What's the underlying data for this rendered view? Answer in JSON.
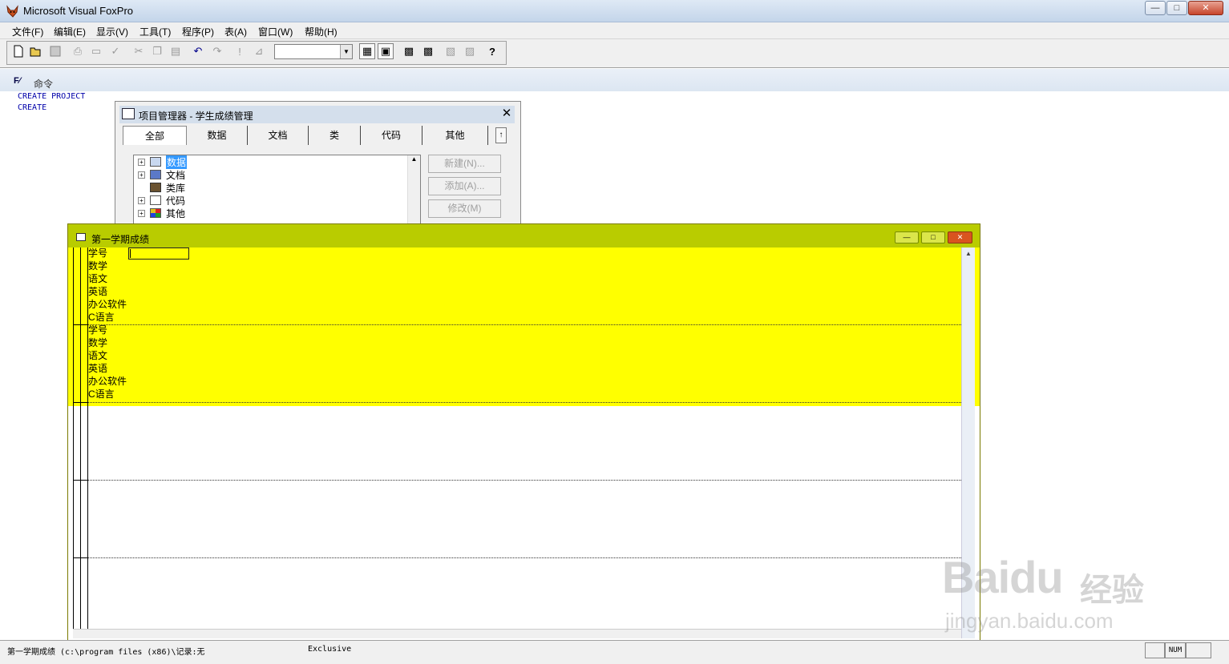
{
  "app": {
    "title": "Microsoft Visual FoxPro"
  },
  "window_controls": {
    "minimize": "—",
    "maximize": "□",
    "close": "✕"
  },
  "menu": [
    {
      "label": "文件(F)"
    },
    {
      "label": "编辑(E)"
    },
    {
      "label": "显示(V)"
    },
    {
      "label": "工具(T)"
    },
    {
      "label": "程序(P)"
    },
    {
      "label": "表(A)"
    },
    {
      "label": "窗口(W)"
    },
    {
      "label": "帮助(H)"
    }
  ],
  "toolbar": {
    "combo_value": "",
    "buttons": [
      "new-icon",
      "open-icon",
      "save-icon",
      "print-icon",
      "print-preview-icon",
      "spell-check-icon",
      "cut-icon",
      "copy-icon",
      "paste-icon",
      "undo-icon",
      "redo-icon",
      "run-icon",
      "modify-form-icon",
      "database-icon",
      "form-wizard-icon",
      "report-icon",
      "build-icon",
      "command-window-icon",
      "view-window-icon",
      "help-icon"
    ]
  },
  "command_window": {
    "title": "命令",
    "lines": [
      "CREATE PROJECT",
      "CREATE"
    ]
  },
  "project_manager": {
    "title": "项目管理器 - 学生成绩管理",
    "tabs": [
      {
        "label": "全部"
      },
      {
        "label": "数据"
      },
      {
        "label": "文档"
      },
      {
        "label": "类"
      },
      {
        "label": "代码"
      },
      {
        "label": "其他"
      }
    ],
    "tree": [
      {
        "label": "数据",
        "expander": "+",
        "selected": true
      },
      {
        "label": "文档",
        "expander": "+"
      },
      {
        "label": "类库",
        "expander": ""
      },
      {
        "label": "代码",
        "expander": "+"
      },
      {
        "label": "其他",
        "expander": "+"
      }
    ],
    "buttons": [
      {
        "label": "新建(N)..."
      },
      {
        "label": "添加(A)..."
      },
      {
        "label": "修改(M)"
      }
    ]
  },
  "browse_window": {
    "title": "第一学期成绩",
    "edit_value": "",
    "records": [
      {
        "fields": [
          "学号",
          "数学",
          "语文",
          "英语",
          "办公软件",
          "C语言"
        ]
      },
      {
        "fields": [
          "学号",
          "数学",
          "语文",
          "英语",
          "办公软件",
          "C语言"
        ]
      }
    ]
  },
  "status": {
    "text": "第一学期成绩  (c:\\program files (x86)\\记录:无",
    "mode": "Exclusive",
    "num": "NUM"
  },
  "watermark": {
    "logo": "Baidu",
    "cn": "经验",
    "url": "jingyan.baidu.com"
  },
  "colors": {
    "browse_highlight": "#ffff00",
    "browse_titlebar": "#b9cc00"
  }
}
